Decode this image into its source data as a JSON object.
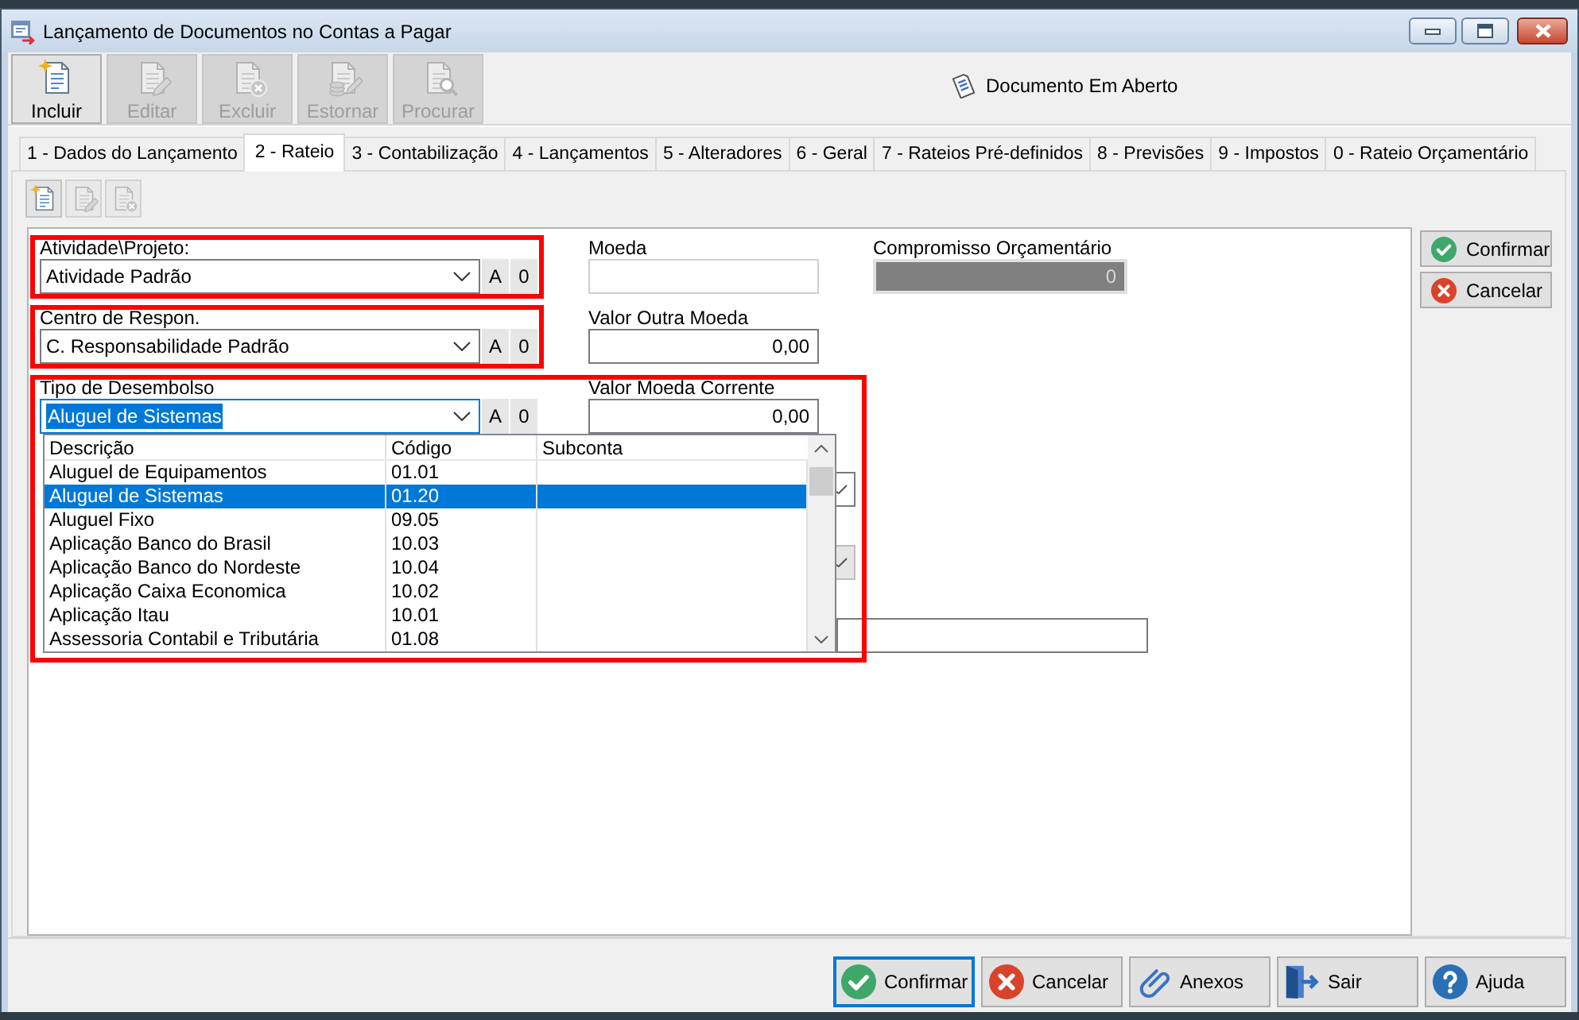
{
  "window": {
    "title": "Lançamento de Documentos no Contas a Pagar"
  },
  "toolbar": {
    "buttons": [
      {
        "label": "Incluir",
        "kind": "new",
        "disabled": false
      },
      {
        "label": "Editar",
        "kind": "edit",
        "disabled": true
      },
      {
        "label": "Excluir",
        "kind": "delete",
        "disabled": true
      },
      {
        "label": "Estornar",
        "kind": "reverse",
        "disabled": true
      },
      {
        "label": "Procurar",
        "kind": "search",
        "disabled": true
      }
    ],
    "status": "Documento Em Aberto"
  },
  "tabs": [
    {
      "label": "1 - Dados do Lançamento",
      "selected": false
    },
    {
      "label": "2 - Rateio",
      "selected": true
    },
    {
      "label": "3 - Contabilização",
      "selected": false
    },
    {
      "label": "4 - Lançamentos",
      "selected": false
    },
    {
      "label": "5 - Alteradores",
      "selected": false
    },
    {
      "label": "6 - Geral",
      "selected": false
    },
    {
      "label": "7 - Rateios Pré-definidos",
      "selected": false
    },
    {
      "label": "8 - Previsões",
      "selected": false
    },
    {
      "label": "9 - Impostos",
      "selected": false
    },
    {
      "label": "0 - Rateio Orçamentário",
      "selected": false
    }
  ],
  "panel_toolbar": {
    "buttons": [
      {
        "kind": "new",
        "disabled": false
      },
      {
        "kind": "edit",
        "disabled": true
      },
      {
        "kind": "delete",
        "disabled": true
      }
    ]
  },
  "form": {
    "rows": [
      {
        "highlight": true,
        "left": {
          "label": "Atividade\\Projeto:",
          "value": "Atividade Padrão",
          "buttons": [
            "A",
            "0"
          ],
          "focused": false
        },
        "middle": {
          "label": "Moeda",
          "kind": "text",
          "disabled": true
        },
        "right": {
          "label": "Compromisso Orçamentário",
          "value": "0",
          "kind": "shaded",
          "disabled": true
        }
      },
      {
        "highlight": true,
        "left": {
          "label": "Centro de Respon.",
          "value": "C. Responsabilidade Padrão",
          "buttons": [
            "A",
            "0"
          ],
          "focused": false
        },
        "middle": {
          "label": "Valor Outra Moeda",
          "value": "0,00",
          "kind": "text",
          "disabled": false
        }
      },
      {
        "highlight": true,
        "left": {
          "label": "Tipo de Desembolso",
          "value": "Aluguel de Sistemas",
          "buttons": [
            "A",
            "0"
          ],
          "focused": true,
          "dropdown": {
            "columns": [
              "Descrição",
              "Código",
              "Subconta"
            ],
            "rows": [
              {
                "description": "Aluguel de Equipamentos",
                "code": "01.01",
                "selected": false
              },
              {
                "description": "Aluguel de Sistemas",
                "code": "01.20",
                "selected": true
              },
              {
                "description": "Aluguel Fixo",
                "code": "09.05",
                "selected": false
              },
              {
                "description": "Aplicação Banco do Brasil",
                "code": "10.03",
                "selected": false
              },
              {
                "description": "Aplicação Banco do Nordeste",
                "code": "10.04",
                "selected": false
              },
              {
                "description": "Aplicação Caixa Economica",
                "code": "10.02",
                "selected": false
              },
              {
                "description": "Aplicação Itau",
                "code": "10.01",
                "selected": false
              },
              {
                "description": "Assessoria Contabil e Tributária",
                "code": "01.08",
                "selected": false
              }
            ]
          }
        },
        "middle": {
          "label": "Valor Moeda Corrente",
          "value": "0,00",
          "kind": "text",
          "disabled": false
        }
      }
    ],
    "covered_fields": [
      {
        "kind": "combo",
        "disabled": false
      },
      {
        "kind": "combo",
        "disabled": true
      },
      {
        "kind": "text",
        "disabled": false
      }
    ]
  },
  "side_buttons": [
    {
      "label": "Confirmar",
      "kind": "confirm"
    },
    {
      "label": "Cancelar",
      "kind": "cancel"
    }
  ],
  "footer": {
    "buttons": [
      {
        "label": "Confirmar",
        "kind": "confirm",
        "focused": true
      },
      {
        "label": "Cancelar",
        "kind": "cancel",
        "focused": false
      },
      {
        "label": "Anexos",
        "kind": "attach",
        "focused": false
      },
      {
        "label": "Sair",
        "kind": "exit",
        "focused": false
      },
      {
        "label": "Ajuda",
        "kind": "help",
        "focused": false
      }
    ]
  }
}
